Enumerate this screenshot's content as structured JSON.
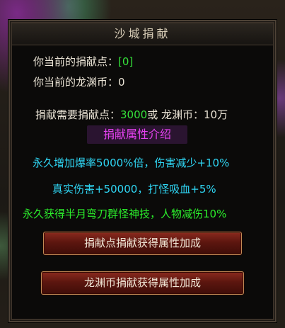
{
  "window": {
    "title": "沙城捐献"
  },
  "status": {
    "points_label": "你当前的捐献点：",
    "points_value": "[0]",
    "coins_label": "你当前的龙渊币：",
    "coins_value": "0"
  },
  "requirement": {
    "prefix": "捐献需要捐献点：",
    "points": "3000",
    "middle": "或 龙渊币：",
    "coins": "10万"
  },
  "attributes": {
    "header": "捐献属性介绍",
    "line1": "永久增加爆率5000%倍，伤害减少+10%",
    "line2": "真实伤害+50000，打怪吸血+5%",
    "line3": "永久获得半月弯刀群怪神技，人物减伤10%"
  },
  "buttons": {
    "donate_points": "捐献点捐献获得属性加成",
    "donate_coins": "龙渊币捐献获得属性加成"
  },
  "colors": {
    "highlight_green": "#35e13a",
    "attribute_cyan": "#2fd7f5",
    "attribute_lime": "#2bed2b",
    "header_magenta": "#e642f0"
  }
}
